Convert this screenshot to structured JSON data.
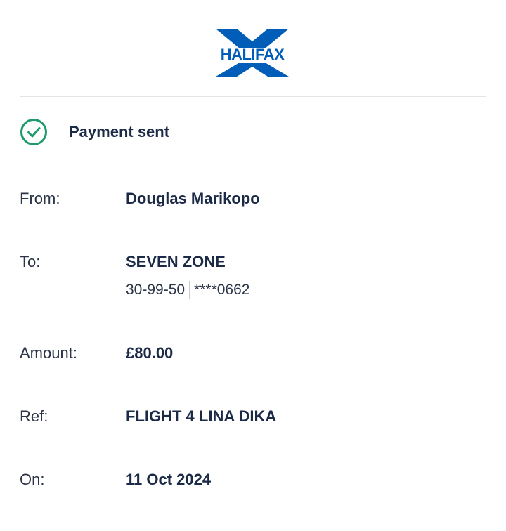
{
  "brand": {
    "name": "HALIFAX",
    "color": "#005EB8"
  },
  "status": {
    "text": "Payment sent",
    "icon": "check-circle-icon",
    "color": "#1f9a6a"
  },
  "details": {
    "from": {
      "label": "From:",
      "value": "Douglas Marikopo"
    },
    "to": {
      "label": "To:",
      "value": "SEVEN ZONE",
      "sort_code": "30-99-50",
      "account": "****0662"
    },
    "amount": {
      "label": "Amount:",
      "value": "£80.00"
    },
    "ref": {
      "label": "Ref:",
      "value": "FLIGHT 4 LINA DIKA"
    },
    "on": {
      "label": "On:",
      "value": "11 Oct 2024"
    }
  }
}
